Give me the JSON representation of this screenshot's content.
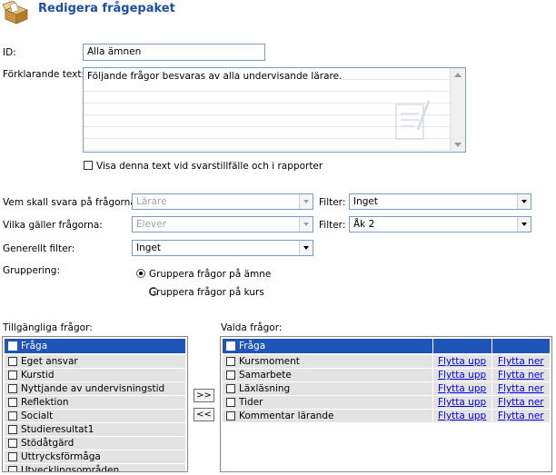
{
  "header": {
    "title": "Redigera frågepaket",
    "icon": "package-icon"
  },
  "form": {
    "id_label": "ID:",
    "id_value": "Alla ämnen",
    "desc_label": "Förklarande text:",
    "desc_value": "Följande frågor besvaras av alla undervisande lärare.",
    "show_text_label": "Visa denna text vid svarstillfälle och i rapporter",
    "who_label": "Vem skall svara på frågorna:",
    "who_value": "Lärare",
    "who_filter_label": "Filter:",
    "who_filter_value": "Inget",
    "applies_label": "Vilka gäller frågorna:",
    "applies_value": "Elever",
    "applies_filter_label": "Filter:",
    "applies_filter_value": "Åk 2",
    "general_filter_label": "Generellt filter:",
    "general_filter_value": "Inget",
    "grouping_label": "Gruppering:",
    "grouping_options": [
      "Gruppera frågor på ämne",
      "Gruppera frågor på kurs"
    ],
    "grouping_selected": 0
  },
  "available": {
    "label": "Tillgängliga frågor:",
    "header": "Fråga",
    "rows": [
      "Eget ansvar",
      "Kurstid",
      "Nyttjande av undervisningstid",
      "Reflektion",
      "Socialt",
      "Studieresultat1",
      "Stödåtgärd",
      "Uttrycksförmåga",
      "Utvecklingsområden"
    ]
  },
  "buttons": {
    "add": ">>",
    "remove": "<<"
  },
  "selected": {
    "label": "Valda frågor:",
    "header": "Fråga",
    "up_label": "Flytta upp",
    "down_label": "Flytta ner",
    "rows": [
      "Kursmoment",
      "Samarbete",
      "Läxläsning",
      "Tider",
      "Kommentar lärande"
    ]
  },
  "colors": {
    "accent": "#1f55b8",
    "title": "#1f4fa8",
    "row_bg": "#e3e3e3",
    "link": "#0000ee"
  }
}
